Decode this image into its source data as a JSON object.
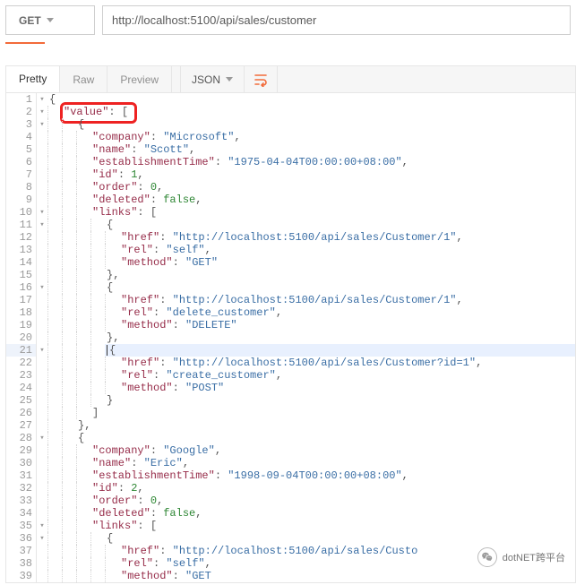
{
  "request": {
    "method": "GET",
    "url": "http://localhost:5100/api/sales/customer"
  },
  "response_toolbar": {
    "tabs": {
      "pretty": "Pretty",
      "raw": "Raw",
      "preview": "Preview"
    },
    "format": "JSON",
    "wrap_icon": "wrap-lines-icon"
  },
  "annotation": {
    "label": "value-key-highlight"
  },
  "watermark": {
    "text": "dotNET跨平台",
    "icon": "wechat-icon"
  },
  "chart_data": {
    "type": "table",
    "title": "JSON response body",
    "records": [
      {
        "company": "Microsoft",
        "name": "Scott",
        "establishmentTime": "1975-04-04T00:00:00+08:00",
        "id": 1,
        "order": 0,
        "deleted": false,
        "links": [
          {
            "href": "http://localhost:5100/api/sales/Customer/1",
            "rel": "self",
            "method": "GET"
          },
          {
            "href": "http://localhost:5100/api/sales/Customer/1",
            "rel": "delete_customer",
            "method": "DELETE"
          },
          {
            "href": "http://localhost:5100/api/sales/Customer?id=1",
            "rel": "create_customer",
            "method": "POST"
          }
        ]
      },
      {
        "company": "Google",
        "name": "Eric",
        "establishmentTime": "1998-09-04T00:00:00+08:00",
        "id": 2,
        "order": 0,
        "deleted": false,
        "links": [
          {
            "href": "http://localhost:5100/api/sales/Custo",
            "rel": "self",
            "method_partial": "\"GET"
          }
        ]
      }
    ]
  },
  "code_lines": [
    {
      "ln": 1,
      "fold": true,
      "depth": 0,
      "hl": false,
      "tokens": [
        {
          "t": "p",
          "v": "{"
        }
      ]
    },
    {
      "ln": 2,
      "fold": true,
      "depth": 1,
      "hl": false,
      "tokens": [
        {
          "t": "k",
          "v": "\"value\""
        },
        {
          "t": "p",
          "v": ": ["
        }
      ]
    },
    {
      "ln": 3,
      "fold": true,
      "depth": 2,
      "hl": false,
      "tokens": [
        {
          "t": "p",
          "v": "{"
        }
      ]
    },
    {
      "ln": 4,
      "fold": false,
      "depth": 3,
      "hl": false,
      "tokens": [
        {
          "t": "k",
          "v": "\"company\""
        },
        {
          "t": "p",
          "v": ": "
        },
        {
          "t": "s",
          "v": "\"Microsoft\""
        },
        {
          "t": "p",
          "v": ","
        }
      ]
    },
    {
      "ln": 5,
      "fold": false,
      "depth": 3,
      "hl": false,
      "tokens": [
        {
          "t": "k",
          "v": "\"name\""
        },
        {
          "t": "p",
          "v": ": "
        },
        {
          "t": "s",
          "v": "\"Scott\""
        },
        {
          "t": "p",
          "v": ","
        }
      ]
    },
    {
      "ln": 6,
      "fold": false,
      "depth": 3,
      "hl": false,
      "tokens": [
        {
          "t": "k",
          "v": "\"establishmentTime\""
        },
        {
          "t": "p",
          "v": ": "
        },
        {
          "t": "s",
          "v": "\"1975-04-04T00:00:00+08:00\""
        },
        {
          "t": "p",
          "v": ","
        }
      ]
    },
    {
      "ln": 7,
      "fold": false,
      "depth": 3,
      "hl": false,
      "tokens": [
        {
          "t": "k",
          "v": "\"id\""
        },
        {
          "t": "p",
          "v": ": "
        },
        {
          "t": "n",
          "v": "1"
        },
        {
          "t": "p",
          "v": ","
        }
      ]
    },
    {
      "ln": 8,
      "fold": false,
      "depth": 3,
      "hl": false,
      "tokens": [
        {
          "t": "k",
          "v": "\"order\""
        },
        {
          "t": "p",
          "v": ": "
        },
        {
          "t": "n",
          "v": "0"
        },
        {
          "t": "p",
          "v": ","
        }
      ]
    },
    {
      "ln": 9,
      "fold": false,
      "depth": 3,
      "hl": false,
      "tokens": [
        {
          "t": "k",
          "v": "\"deleted\""
        },
        {
          "t": "p",
          "v": ": "
        },
        {
          "t": "b",
          "v": "false"
        },
        {
          "t": "p",
          "v": ","
        }
      ]
    },
    {
      "ln": 10,
      "fold": true,
      "depth": 3,
      "hl": false,
      "tokens": [
        {
          "t": "k",
          "v": "\"links\""
        },
        {
          "t": "p",
          "v": ": ["
        }
      ]
    },
    {
      "ln": 11,
      "fold": true,
      "depth": 4,
      "hl": false,
      "tokens": [
        {
          "t": "p",
          "v": "{"
        }
      ]
    },
    {
      "ln": 12,
      "fold": false,
      "depth": 5,
      "hl": false,
      "tokens": [
        {
          "t": "k",
          "v": "\"href\""
        },
        {
          "t": "p",
          "v": ": "
        },
        {
          "t": "s",
          "v": "\"http://localhost:5100/api/sales/Customer/1\""
        },
        {
          "t": "p",
          "v": ","
        }
      ]
    },
    {
      "ln": 13,
      "fold": false,
      "depth": 5,
      "hl": false,
      "tokens": [
        {
          "t": "k",
          "v": "\"rel\""
        },
        {
          "t": "p",
          "v": ": "
        },
        {
          "t": "s",
          "v": "\"self\""
        },
        {
          "t": "p",
          "v": ","
        }
      ]
    },
    {
      "ln": 14,
      "fold": false,
      "depth": 5,
      "hl": false,
      "tokens": [
        {
          "t": "k",
          "v": "\"method\""
        },
        {
          "t": "p",
          "v": ": "
        },
        {
          "t": "s",
          "v": "\"GET\""
        }
      ]
    },
    {
      "ln": 15,
      "fold": false,
      "depth": 4,
      "hl": false,
      "tokens": [
        {
          "t": "p",
          "v": "},"
        }
      ]
    },
    {
      "ln": 16,
      "fold": true,
      "depth": 4,
      "hl": false,
      "tokens": [
        {
          "t": "p",
          "v": "{"
        }
      ]
    },
    {
      "ln": 17,
      "fold": false,
      "depth": 5,
      "hl": false,
      "tokens": [
        {
          "t": "k",
          "v": "\"href\""
        },
        {
          "t": "p",
          "v": ": "
        },
        {
          "t": "s",
          "v": "\"http://localhost:5100/api/sales/Customer/1\""
        },
        {
          "t": "p",
          "v": ","
        }
      ]
    },
    {
      "ln": 18,
      "fold": false,
      "depth": 5,
      "hl": false,
      "tokens": [
        {
          "t": "k",
          "v": "\"rel\""
        },
        {
          "t": "p",
          "v": ": "
        },
        {
          "t": "s",
          "v": "\"delete_customer\""
        },
        {
          "t": "p",
          "v": ","
        }
      ]
    },
    {
      "ln": 19,
      "fold": false,
      "depth": 5,
      "hl": false,
      "tokens": [
        {
          "t": "k",
          "v": "\"method\""
        },
        {
          "t": "p",
          "v": ": "
        },
        {
          "t": "s",
          "v": "\"DELETE\""
        }
      ]
    },
    {
      "ln": 20,
      "fold": false,
      "depth": 4,
      "hl": false,
      "tokens": [
        {
          "t": "p",
          "v": "},"
        }
      ]
    },
    {
      "ln": 21,
      "fold": true,
      "depth": 4,
      "hl": true,
      "cursor": true,
      "tokens": [
        {
          "t": "p",
          "v": "{"
        }
      ]
    },
    {
      "ln": 22,
      "fold": false,
      "depth": 5,
      "hl": false,
      "tokens": [
        {
          "t": "k",
          "v": "\"href\""
        },
        {
          "t": "p",
          "v": ": "
        },
        {
          "t": "s",
          "v": "\"http://localhost:5100/api/sales/Customer?id=1\""
        },
        {
          "t": "p",
          "v": ","
        }
      ]
    },
    {
      "ln": 23,
      "fold": false,
      "depth": 5,
      "hl": false,
      "tokens": [
        {
          "t": "k",
          "v": "\"rel\""
        },
        {
          "t": "p",
          "v": ": "
        },
        {
          "t": "s",
          "v": "\"create_customer\""
        },
        {
          "t": "p",
          "v": ","
        }
      ]
    },
    {
      "ln": 24,
      "fold": false,
      "depth": 5,
      "hl": false,
      "tokens": [
        {
          "t": "k",
          "v": "\"method\""
        },
        {
          "t": "p",
          "v": ": "
        },
        {
          "t": "s",
          "v": "\"POST\""
        }
      ]
    },
    {
      "ln": 25,
      "fold": false,
      "depth": 4,
      "hl": false,
      "tokens": [
        {
          "t": "p",
          "v": "}"
        }
      ]
    },
    {
      "ln": 26,
      "fold": false,
      "depth": 3,
      "hl": false,
      "tokens": [
        {
          "t": "p",
          "v": "]"
        }
      ]
    },
    {
      "ln": 27,
      "fold": false,
      "depth": 2,
      "hl": false,
      "tokens": [
        {
          "t": "p",
          "v": "},"
        }
      ]
    },
    {
      "ln": 28,
      "fold": true,
      "depth": 2,
      "hl": false,
      "tokens": [
        {
          "t": "p",
          "v": "{"
        }
      ]
    },
    {
      "ln": 29,
      "fold": false,
      "depth": 3,
      "hl": false,
      "tokens": [
        {
          "t": "k",
          "v": "\"company\""
        },
        {
          "t": "p",
          "v": ": "
        },
        {
          "t": "s",
          "v": "\"Google\""
        },
        {
          "t": "p",
          "v": ","
        }
      ]
    },
    {
      "ln": 30,
      "fold": false,
      "depth": 3,
      "hl": false,
      "tokens": [
        {
          "t": "k",
          "v": "\"name\""
        },
        {
          "t": "p",
          "v": ": "
        },
        {
          "t": "s",
          "v": "\"Eric\""
        },
        {
          "t": "p",
          "v": ","
        }
      ]
    },
    {
      "ln": 31,
      "fold": false,
      "depth": 3,
      "hl": false,
      "tokens": [
        {
          "t": "k",
          "v": "\"establishmentTime\""
        },
        {
          "t": "p",
          "v": ": "
        },
        {
          "t": "s",
          "v": "\"1998-09-04T00:00:00+08:00\""
        },
        {
          "t": "p",
          "v": ","
        }
      ]
    },
    {
      "ln": 32,
      "fold": false,
      "depth": 3,
      "hl": false,
      "tokens": [
        {
          "t": "k",
          "v": "\"id\""
        },
        {
          "t": "p",
          "v": ": "
        },
        {
          "t": "n",
          "v": "2"
        },
        {
          "t": "p",
          "v": ","
        }
      ]
    },
    {
      "ln": 33,
      "fold": false,
      "depth": 3,
      "hl": false,
      "tokens": [
        {
          "t": "k",
          "v": "\"order\""
        },
        {
          "t": "p",
          "v": ": "
        },
        {
          "t": "n",
          "v": "0"
        },
        {
          "t": "p",
          "v": ","
        }
      ]
    },
    {
      "ln": 34,
      "fold": false,
      "depth": 3,
      "hl": false,
      "tokens": [
        {
          "t": "k",
          "v": "\"deleted\""
        },
        {
          "t": "p",
          "v": ": "
        },
        {
          "t": "b",
          "v": "false"
        },
        {
          "t": "p",
          "v": ","
        }
      ]
    },
    {
      "ln": 35,
      "fold": true,
      "depth": 3,
      "hl": false,
      "tokens": [
        {
          "t": "k",
          "v": "\"links\""
        },
        {
          "t": "p",
          "v": ": ["
        }
      ]
    },
    {
      "ln": 36,
      "fold": true,
      "depth": 4,
      "hl": false,
      "tokens": [
        {
          "t": "p",
          "v": "{"
        }
      ]
    },
    {
      "ln": 37,
      "fold": false,
      "depth": 5,
      "hl": false,
      "tokens": [
        {
          "t": "k",
          "v": "\"href\""
        },
        {
          "t": "p",
          "v": ": "
        },
        {
          "t": "s",
          "v": "\"http://localhost:5100/api/sales/Custo"
        }
      ]
    },
    {
      "ln": 38,
      "fold": false,
      "depth": 5,
      "hl": false,
      "tokens": [
        {
          "t": "k",
          "v": "\"rel\""
        },
        {
          "t": "p",
          "v": ": "
        },
        {
          "t": "s",
          "v": "\"self\""
        },
        {
          "t": "p",
          "v": ","
        }
      ]
    },
    {
      "ln": 39,
      "fold": false,
      "depth": 5,
      "hl": false,
      "tokens": [
        {
          "t": "k",
          "v": "\"method\""
        },
        {
          "t": "p",
          "v": ": "
        },
        {
          "t": "s",
          "v": "\"GET"
        }
      ]
    }
  ]
}
